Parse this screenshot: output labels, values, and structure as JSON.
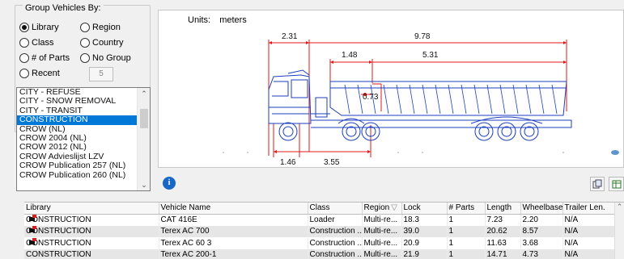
{
  "group": {
    "title": "Group Vehicles By:",
    "options": [
      {
        "label": "Library",
        "selected": true
      },
      {
        "label": "Region",
        "selected": false
      },
      {
        "label": "Class",
        "selected": false
      },
      {
        "label": "Country",
        "selected": false
      },
      {
        "label": "# of Parts",
        "selected": false
      },
      {
        "label": "No Group",
        "selected": false
      },
      {
        "label": "Recent",
        "selected": false
      }
    ],
    "recent_count": "5"
  },
  "library_list": {
    "items": [
      "CITY - REFUSE",
      "CITY - SNOW REMOVAL",
      "CITY - TRANSIT",
      "CONSTRUCTION",
      "CROW (NL)",
      "CROW 2004 (NL)",
      "CROW 2012 (NL)",
      "CROW Advieslijst LZV",
      "CROW Publication 257 (NL)",
      "CROW Publication 260 (NL)"
    ],
    "selected": "CONSTRUCTION"
  },
  "preview": {
    "units_label": "Units:",
    "units_value": "meters",
    "dimensions": {
      "front_overhang": "2.31",
      "overall_length": "9.78",
      "body_offset": "1.48",
      "body_length": "5.31",
      "articulation": "0.73",
      "front_axle": "1.46",
      "wheelbase": "3.55"
    }
  },
  "icons": {
    "info": "info-icon",
    "copy": "copy-icon",
    "export": "export-icon",
    "row": "vehicle-row-icon"
  },
  "grid": {
    "columns": [
      "Library",
      "Vehicle Name",
      "Class",
      "Region",
      "Lock",
      "# Parts",
      "Length",
      "Wheelbase",
      "Trailer Len."
    ],
    "rows": [
      {
        "library": "CONSTRUCTION",
        "name": "CAT 416E",
        "class": "Loader",
        "region": "Multi-re...",
        "lock": "18.3",
        "parts": "1",
        "length": "7.23",
        "wheelbase": "2.20",
        "trailer": "N/A"
      },
      {
        "library": "CONSTRUCTION",
        "name": "Terex AC 700",
        "class": "Construction ...",
        "region": "Multi-re...",
        "lock": "39.0",
        "parts": "1",
        "length": "20.62",
        "wheelbase": "8.57",
        "trailer": "N/A"
      },
      {
        "library": "CONSTRUCTION",
        "name": "Terex AC 60 3",
        "class": "Construction ...",
        "region": "Multi-re...",
        "lock": "20.9",
        "parts": "1",
        "length": "11.63",
        "wheelbase": "3.68",
        "trailer": "N/A"
      },
      {
        "library": "CONSTRUCTION",
        "name": "Terex AC 200-1",
        "class": "Construction ...",
        "region": "Multi-re...",
        "lock": "21.9",
        "parts": "1",
        "length": "14.71",
        "wheelbase": "4.73",
        "trailer": "N/A"
      }
    ]
  },
  "colors": {
    "selection": "#0078d7",
    "drawing_blue": "#1c3fbf",
    "dimension_red": "#e01818"
  }
}
